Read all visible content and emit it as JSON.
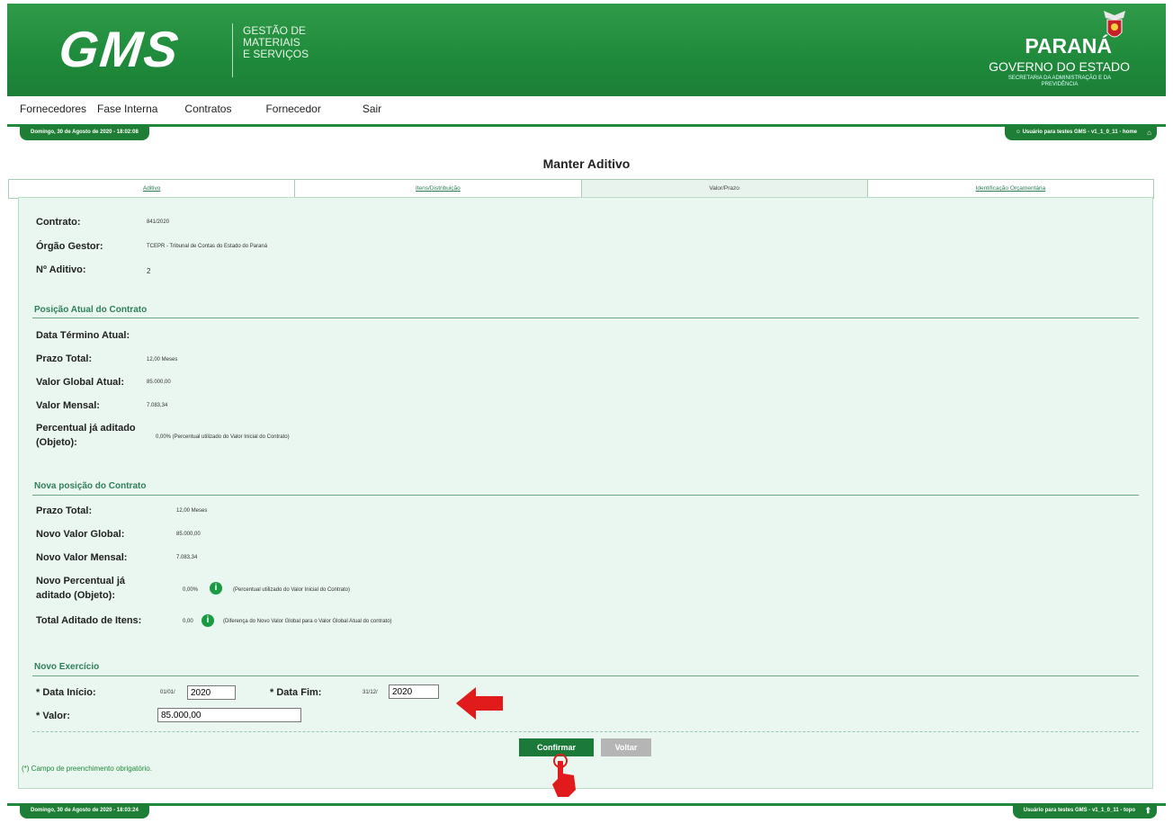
{
  "header": {
    "logo": "GMS",
    "subtitle_lines": [
      "GESTÃO DE",
      "MATERIAIS",
      "E SERVIÇOS"
    ],
    "state": "PARANÁ",
    "government": "GOVERNO DO ESTADO",
    "secretaria": "SECRETARIA DA ADMINISTRAÇÃO E DA PREVIDÊNCIA"
  },
  "menu": [
    "Fornecedores",
    "Fase Interna",
    "Contratos",
    "Fornecedor",
    "Sair"
  ],
  "top_bar": {
    "date": "Domingo, 30 de Agosto de 2020 - 18:02:08",
    "user": "Usuário para testes GMS - v1_1_0_11 - home"
  },
  "page_title": "Manter Aditivo",
  "tabs": [
    "Aditivo",
    "Itens/Distribuição",
    "Valor/Prazo",
    "Identificação Orçamentária"
  ],
  "header_info": {
    "contrato_label": "Contrato:",
    "contrato": "841/2020",
    "orgao_label": "Órgão Gestor:",
    "orgao": "TCEPR - Tribunal de Contas do Estado do Paraná",
    "aditivo_label": "Nº Aditivo:",
    "aditivo": "2"
  },
  "posicao_atual": {
    "title": "Posição Atual do Contrato",
    "data_termino_label": "Data Término Atual:",
    "prazo_label": "Prazo Total:",
    "prazo": "12,00 Meses",
    "valor_global_label": "Valor Global Atual:",
    "valor_global": "85.000,00",
    "valor_mensal_label": "Valor Mensal:",
    "valor_mensal": "7.083,34",
    "percentual_label_1": "Percentual já aditado",
    "percentual_label_2": "(Objeto):",
    "percentual": "0,00% (Percentual utilizado do Valor Inicial do Contrato)"
  },
  "nova_posicao": {
    "title": "Nova posição do Contrato",
    "prazo_label": "Prazo Total:",
    "prazo": "12,00 Meses",
    "global_label": "Novo Valor Global:",
    "global": "85.000,00",
    "mensal_label": "Novo Valor Mensal:",
    "mensal": "7.083,34",
    "perc_label_1": "Novo Percentual já",
    "perc_label_2": "aditado (Objeto):",
    "perc": "0,00%",
    "perc_note": "(Percentual utilizado do Valor Inicial do Contrato)",
    "total_label": "Total Aditado de Itens:",
    "total": "0,00",
    "total_note": "(Diferença do Novo Valor Global para o Valor Global Atual do contrato)"
  },
  "novo_exercicio": {
    "title": "Novo Exercício",
    "inicio_label": "* Data Início:",
    "inicio_prefix": "01/01/",
    "inicio_year": "2020",
    "fim_label": "* Data Fim:",
    "fim_prefix": "31/12/",
    "fim_year": "2020",
    "valor_label": "* Valor:",
    "valor": "85.000,00"
  },
  "buttons": {
    "confirm": "Confirmar",
    "back": "Voltar"
  },
  "footnote": "(*) Campo de preenchimento obrigatório.",
  "bottom_bar": {
    "date": "Domingo, 30 de Agosto de 2020 - 18:03:24",
    "user": "Usuário para testes GMS - v1_1_0_11 - topo"
  },
  "colors": {
    "brand_green": "#1f8a3b",
    "panel_bg": "#eaf6f0",
    "arrow_red": "#e11b1b"
  },
  "icons": [
    "user-icon",
    "home-icon",
    "info-icon",
    "up-arrow-icon",
    "red-arrow-icon",
    "hand-cursor-icon"
  ]
}
